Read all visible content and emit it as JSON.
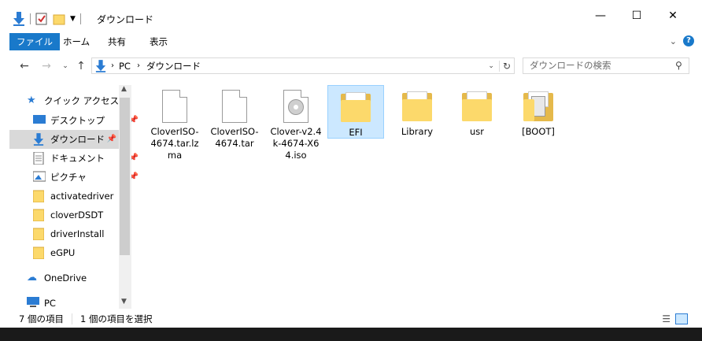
{
  "window": {
    "title": "ダウンロード",
    "controls": {
      "minimize": "—",
      "maximize": "☐",
      "close": "✕"
    }
  },
  "ribbon": {
    "tabs": [
      {
        "label": "ファイル",
        "active": true
      },
      {
        "label": "ホーム"
      },
      {
        "label": "共有"
      },
      {
        "label": "表示"
      }
    ]
  },
  "address": {
    "segments": [
      "PC",
      "ダウンロード"
    ],
    "search_placeholder": "ダウンロードの検索"
  },
  "sidebar": {
    "items": [
      {
        "label": "クイック アクセス",
        "icon": "star-icon"
      },
      {
        "label": "デスクトップ",
        "icon": "desktop-icon",
        "pinned": true
      },
      {
        "label": "ダウンロード",
        "icon": "download-icon",
        "pinned": true,
        "selected": true
      },
      {
        "label": "ドキュメント",
        "icon": "document-icon",
        "pinned": true
      },
      {
        "label": "ピクチャ",
        "icon": "picture-icon",
        "pinned": true
      },
      {
        "label": "activatedriver",
        "icon": "folder-icon"
      },
      {
        "label": "cloverDSDT",
        "icon": "folder-icon"
      },
      {
        "label": "driverInstall",
        "icon": "folder-icon"
      },
      {
        "label": "eGPU",
        "icon": "folder-icon"
      },
      {
        "label": "OneDrive",
        "icon": "cloud-icon"
      },
      {
        "label": "PC",
        "icon": "pc-icon"
      }
    ]
  },
  "files": [
    {
      "name": "CloverISO-4674.tar.lzma",
      "type": "file"
    },
    {
      "name": "CloverISO-4674.tar",
      "type": "file"
    },
    {
      "name": "Clover-v2.4k-4674-X64.iso",
      "type": "disc"
    },
    {
      "name": "EFI",
      "type": "folder",
      "selected": true
    },
    {
      "name": "Library",
      "type": "folder"
    },
    {
      "name": "usr",
      "type": "folder"
    },
    {
      "name": "[BOOT]",
      "type": "folder-doc"
    }
  ],
  "status": {
    "item_count": "7 個の項目",
    "selection": "1 個の項目を選択"
  },
  "colors": {
    "accent": "#1979ca",
    "selection_bg": "#cce8ff",
    "folder": "#fcd96b"
  }
}
